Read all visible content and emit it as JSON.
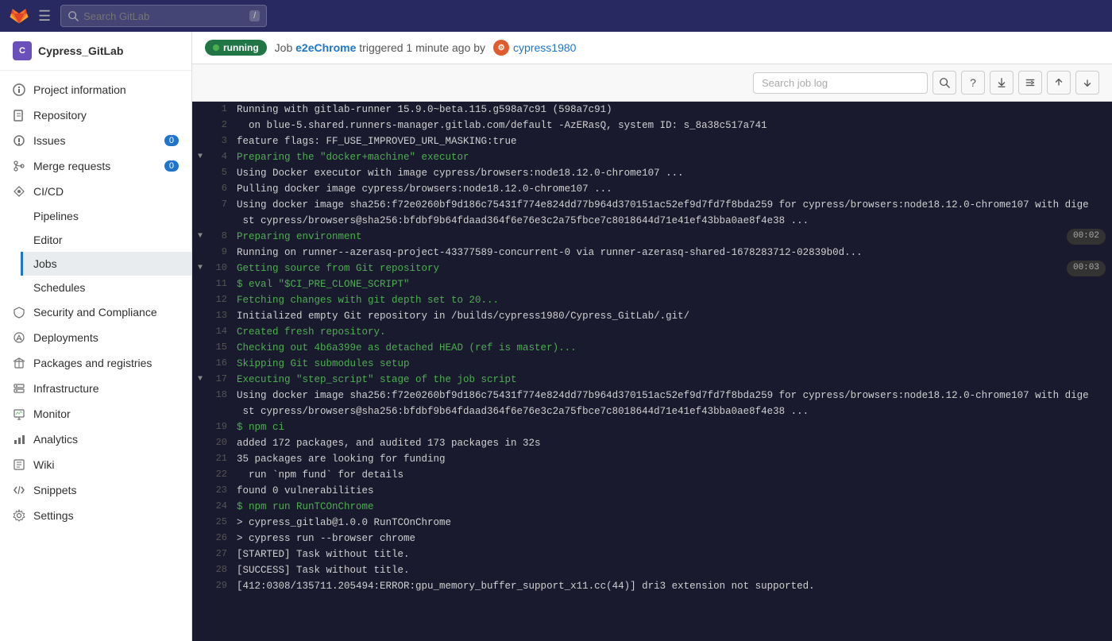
{
  "navbar": {
    "search_placeholder": "Search GitLab",
    "slash_key": "/",
    "hamburger_label": "≡"
  },
  "sidebar": {
    "project_initial": "C",
    "project_name": "Cypress_GitLab",
    "items": [
      {
        "id": "project-information",
        "label": "Project information",
        "icon": "info-icon",
        "badge": null
      },
      {
        "id": "repository",
        "label": "Repository",
        "icon": "repo-icon",
        "badge": null
      },
      {
        "id": "issues",
        "label": "Issues",
        "icon": "issues-icon",
        "badge": "0"
      },
      {
        "id": "merge-requests",
        "label": "Merge requests",
        "icon": "merge-icon",
        "badge": "0"
      },
      {
        "id": "cicd",
        "label": "CI/CD",
        "icon": "cicd-icon",
        "badge": null,
        "expanded": true,
        "children": [
          {
            "id": "pipelines",
            "label": "Pipelines"
          },
          {
            "id": "editor",
            "label": "Editor"
          },
          {
            "id": "jobs",
            "label": "Jobs",
            "active": true
          }
        ]
      },
      {
        "id": "security",
        "label": "Security and Compliance",
        "icon": "shield-icon",
        "badge": null
      },
      {
        "id": "deployments",
        "label": "Deployments",
        "icon": "deploy-icon",
        "badge": null
      },
      {
        "id": "packages",
        "label": "Packages and registries",
        "icon": "package-icon",
        "badge": null
      },
      {
        "id": "infrastructure",
        "label": "Infrastructure",
        "icon": "infra-icon",
        "badge": null
      },
      {
        "id": "monitor",
        "label": "Monitor",
        "icon": "monitor-icon",
        "badge": null
      },
      {
        "id": "analytics",
        "label": "Analytics",
        "icon": "analytics-icon",
        "badge": null
      },
      {
        "id": "wiki",
        "label": "Wiki",
        "icon": "wiki-icon",
        "badge": null
      },
      {
        "id": "snippets",
        "label": "Snippets",
        "icon": "snippet-icon",
        "badge": null
      },
      {
        "id": "settings",
        "label": "Settings",
        "icon": "settings-icon",
        "badge": null
      }
    ]
  },
  "job_header": {
    "status": "running",
    "job_label": "Job",
    "job_name": "e2eChrome",
    "triggered_text": "triggered 1 minute ago by",
    "actor_name": "cypress1980"
  },
  "log_toolbar": {
    "search_placeholder": "Search job log"
  },
  "log_lines": [
    {
      "num": 1,
      "indent": false,
      "toggle": false,
      "content": "Running with gitlab-runner 15.9.0~beta.115.g598a7c91 (598a7c91)",
      "color": "default",
      "time": null
    },
    {
      "num": 2,
      "indent": false,
      "toggle": false,
      "content": "  on blue-5.shared.runners-manager.gitlab.com/default -AzERasQ, system ID: s_8a38c517a741",
      "color": "default",
      "time": null
    },
    {
      "num": 3,
      "indent": false,
      "toggle": false,
      "content": "feature flags: FF_USE_IMPROVED_URL_MASKING:true",
      "color": "default",
      "time": null
    },
    {
      "num": 4,
      "indent": true,
      "toggle": true,
      "content": "Preparing the \"docker+machine\" executor",
      "color": "green",
      "time": null
    },
    {
      "num": 5,
      "indent": false,
      "toggle": false,
      "content": "Using Docker executor with image cypress/browsers:node18.12.0-chrome107 ...",
      "color": "default",
      "time": null
    },
    {
      "num": 6,
      "indent": false,
      "toggle": false,
      "content": "Pulling docker image cypress/browsers:node18.12.0-chrome107 ...",
      "color": "default",
      "time": null
    },
    {
      "num": 7,
      "indent": false,
      "toggle": false,
      "content": "Using docker image sha256:f72e0260bf9d186c75431f774e824dd77b964d370151ac52ef9d7fd7f8bda259 for cypress/browsers:node18.12.0-chrome107 with dige\n st cypress/browsers@sha256:bfdbf9b64fdaad364f6e76e3c2a75fbce7c8018644d71e41ef43bba0ae8f4e38 ...",
      "color": "default",
      "time": null
    },
    {
      "num": 8,
      "indent": true,
      "toggle": true,
      "content": "Preparing environment",
      "color": "green",
      "time": "00:02"
    },
    {
      "num": 9,
      "indent": false,
      "toggle": false,
      "content": "Running on runner--azerasq-project-43377589-concurrent-0 via runner-azerasq-shared-1678283712-02839b0d...",
      "color": "default",
      "time": null
    },
    {
      "num": 10,
      "indent": true,
      "toggle": true,
      "content": "Getting source from Git repository",
      "color": "green",
      "time": "00:03"
    },
    {
      "num": 11,
      "indent": false,
      "toggle": false,
      "content": "$ eval \"$CI_PRE_CLONE_SCRIPT\"",
      "color": "green",
      "time": null
    },
    {
      "num": 12,
      "indent": false,
      "toggle": false,
      "content": "Fetching changes with git depth set to 20...",
      "color": "green",
      "time": null
    },
    {
      "num": 13,
      "indent": false,
      "toggle": false,
      "content": "Initialized empty Git repository in /builds/cypress1980/Cypress_GitLab/.git/",
      "color": "default",
      "time": null
    },
    {
      "num": 14,
      "indent": false,
      "toggle": false,
      "content": "Created fresh repository.",
      "color": "green",
      "time": null
    },
    {
      "num": 15,
      "indent": false,
      "toggle": false,
      "content": "Checking out 4b6a399e as detached HEAD (ref is master)...",
      "color": "green",
      "time": null
    },
    {
      "num": 16,
      "indent": false,
      "toggle": false,
      "content": "Skipping Git submodules setup",
      "color": "green",
      "time": null
    },
    {
      "num": 17,
      "indent": true,
      "toggle": true,
      "content": "Executing \"step_script\" stage of the job script",
      "color": "green",
      "time": null
    },
    {
      "num": 18,
      "indent": false,
      "toggle": false,
      "content": "Using docker image sha256:f72e0260bf9d186c75431f774e824dd77b964d370151ac52ef9d7fd7f8bda259 for cypress/browsers:node18.12.0-chrome107 with dige\n st cypress/browsers@sha256:bfdbf9b64fdaad364f6e76e3c2a75fbce7c8018644d71e41ef43bba0ae8f4e38 ...",
      "color": "default",
      "time": null
    },
    {
      "num": 19,
      "indent": false,
      "toggle": false,
      "content": "$ npm ci",
      "color": "green",
      "time": null
    },
    {
      "num": 20,
      "indent": false,
      "toggle": false,
      "content": "added 172 packages, and audited 173 packages in 32s",
      "color": "default",
      "time": null
    },
    {
      "num": 21,
      "indent": false,
      "toggle": false,
      "content": "35 packages are looking for funding",
      "color": "default",
      "time": null
    },
    {
      "num": 22,
      "indent": false,
      "toggle": false,
      "content": "  run `npm fund` for details",
      "color": "default",
      "time": null
    },
    {
      "num": 23,
      "indent": false,
      "toggle": false,
      "content": "found 0 vulnerabilities",
      "color": "default",
      "time": null
    },
    {
      "num": 24,
      "indent": false,
      "toggle": false,
      "content": "$ npm run RunTCOnChrome",
      "color": "green",
      "time": null
    },
    {
      "num": 25,
      "indent": false,
      "toggle": false,
      "content": "> cypress_gitlab@1.0.0 RunTCOnChrome",
      "color": "default",
      "time": null
    },
    {
      "num": 26,
      "indent": false,
      "toggle": false,
      "content": "> cypress run --browser chrome",
      "color": "default",
      "time": null
    },
    {
      "num": 27,
      "indent": false,
      "toggle": false,
      "content": "[STARTED] Task without title.",
      "color": "default",
      "time": null
    },
    {
      "num": 28,
      "indent": false,
      "toggle": false,
      "content": "[SUCCESS] Task without title.",
      "color": "default",
      "time": null
    },
    {
      "num": 29,
      "indent": false,
      "toggle": false,
      "content": "[412:0308/135711.205494:ERROR:gpu_memory_buffer_support_x11.cc(44)] dri3 extension not supported.",
      "color": "default",
      "time": null
    }
  ]
}
